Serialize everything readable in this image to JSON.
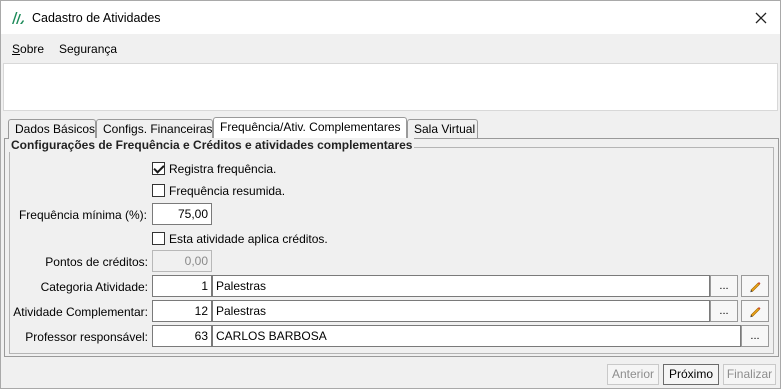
{
  "window": {
    "title": "Cadastro de Atividades"
  },
  "menu": {
    "sobre_first": "S",
    "sobre_rest": "obre",
    "seguranca": "Segurança"
  },
  "tabs": [
    {
      "label": "Dados Básicos"
    },
    {
      "label": "Configs. Financeiras"
    },
    {
      "label": "Frequência/Ativ. Complementares"
    },
    {
      "label": "Sala Virtual"
    }
  ],
  "group": {
    "title": "Configurações de Frequência e Créditos e atividades complementares"
  },
  "form": {
    "registra_frequencia": {
      "label": "Registra frequência.",
      "checked": true
    },
    "frequencia_resumida": {
      "label": "Frequência resumida.",
      "checked": false
    },
    "frequencia_minima": {
      "label": "Frequência mínima (%):",
      "value": "75,00"
    },
    "aplica_creditos": {
      "label": "Esta atividade aplica créditos.",
      "checked": false
    },
    "pontos_creditos": {
      "label": "Pontos de créditos:",
      "value": "0,00"
    },
    "categoria": {
      "label": "Categoria Atividade:",
      "code": "1",
      "name": "Palestras"
    },
    "complementar": {
      "label": "Atividade Complementar:",
      "code": "12",
      "name": "Palestras"
    },
    "professor": {
      "label": "Professor responsável:",
      "code": "63",
      "name": "CARLOS BARBOSA"
    },
    "lookup_label": "..."
  },
  "footer": {
    "anterior": "Anterior",
    "proximo": "Próximo",
    "finalizar": "Finalizar"
  }
}
